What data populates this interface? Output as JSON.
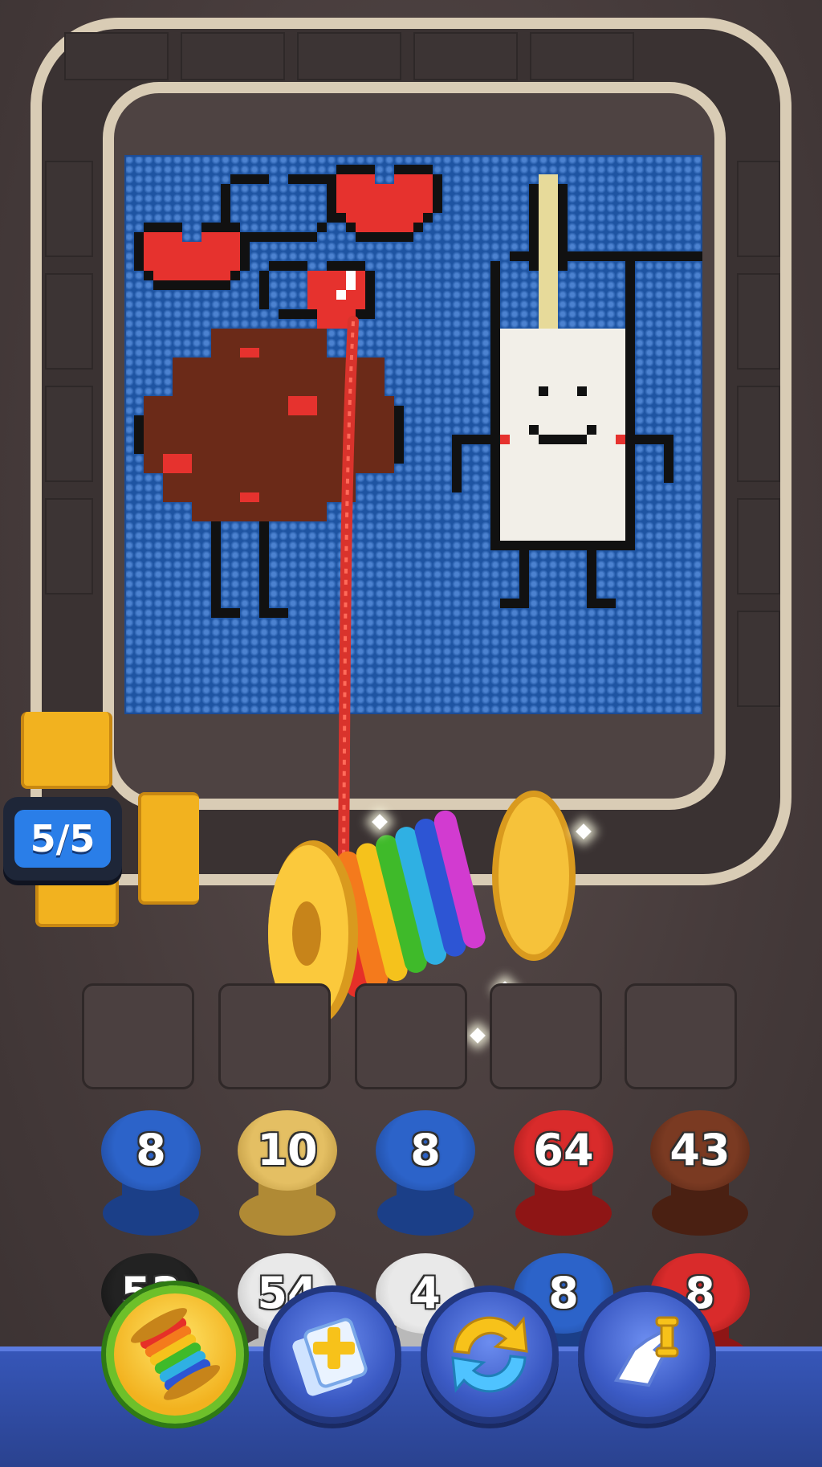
{
  "game": {
    "progress_counter": "5/5"
  },
  "spools_row1": [
    {
      "label": "8",
      "color": "#2c63c9",
      "dark": "#1b3f88"
    },
    {
      "label": "10",
      "color": "#e4bf63",
      "dark": "#b08a35"
    },
    {
      "label": "8",
      "color": "#2c63c9",
      "dark": "#1b3f88"
    },
    {
      "label": "64",
      "color": "#d92b2b",
      "dark": "#8e1515"
    },
    {
      "label": "43",
      "color": "#7a3a22",
      "dark": "#4a2012"
    }
  ],
  "spools_row2": [
    {
      "label": "53",
      "color": "#222222",
      "dark": "#111111"
    },
    {
      "label": "54",
      "color": "#e9e9e9",
      "dark": "#b9b9b9"
    },
    {
      "label": "4",
      "color": "#e9e9e9",
      "dark": "#b9b9b9"
    },
    {
      "label": "8",
      "color": "#2c63c9",
      "dark": "#1b3f88"
    },
    {
      "label": "8",
      "color": "#d92b2b",
      "dark": "#8e1515"
    }
  ],
  "toolbar": [
    {
      "name": "rainbow-spool-booster-button",
      "icon": "rainbow-spool-icon"
    },
    {
      "name": "add-slot-booster-button",
      "icon": "add-card-icon"
    },
    {
      "name": "shuffle-booster-button",
      "icon": "shuffle-arrows-icon"
    },
    {
      "name": "pick-booster-button",
      "icon": "pointing-hand-icon"
    }
  ],
  "colors": {
    "canvas_blue": "#2566c6",
    "rail": "#d9ccb5",
    "hanger_gold": "#f2b21f",
    "bar_blue": "#3656b8"
  }
}
